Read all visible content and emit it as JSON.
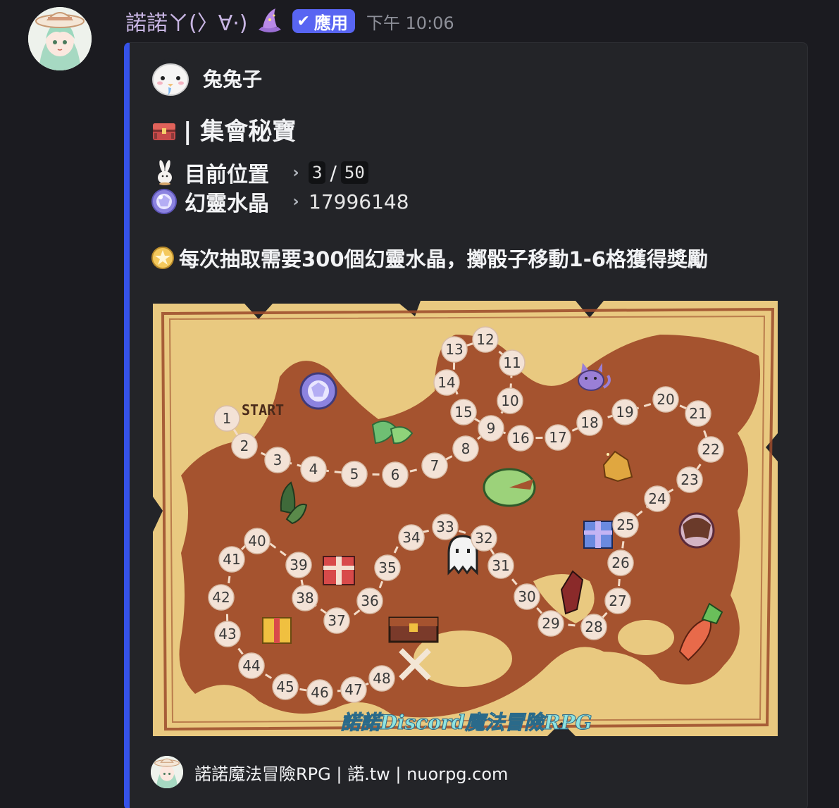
{
  "message": {
    "username": "諾諾ㄚ(〉∀·)",
    "badge_label": "應用",
    "timestamp": "下午 10:06",
    "avatar_icon": "anime-girl-avatar",
    "hat_icon": "wizard-hat-icon"
  },
  "embed": {
    "accent_color": "#3552e8",
    "author": {
      "name": "兔兔子",
      "icon": "white-bird-icon"
    },
    "title": "| 集會秘寶",
    "fields": [
      {
        "label": "目前位置",
        "icon": "rabbit-icon",
        "current": "3",
        "total": "50"
      },
      {
        "label": "幻靈水晶",
        "icon": "crystal-orb-icon",
        "value": "17996148"
      }
    ],
    "description": "每次抽取需要300個幻靈水晶，擲骰子移動1-6格獲得獎勵",
    "image": {
      "start_label": "START",
      "watermark": "諾諾Discord魔法冒險RPG",
      "board_numbers": [
        "1",
        "2",
        "3",
        "4",
        "5",
        "6",
        "7",
        "8",
        "9",
        "10",
        "11",
        "12",
        "13",
        "14",
        "15",
        "16",
        "17",
        "18",
        "19",
        "20",
        "21",
        "22",
        "23",
        "24",
        "25",
        "26",
        "27",
        "28",
        "29",
        "30",
        "31",
        "32",
        "33",
        "34",
        "35",
        "36",
        "37",
        "38",
        "39",
        "40",
        "41",
        "42",
        "43",
        "44",
        "45",
        "46",
        "47",
        "48"
      ]
    },
    "footer": {
      "text": "諾諾魔法冒險RPG | 諾.tw | nuorpg.com",
      "icon": "anime-girl-avatar"
    }
  }
}
